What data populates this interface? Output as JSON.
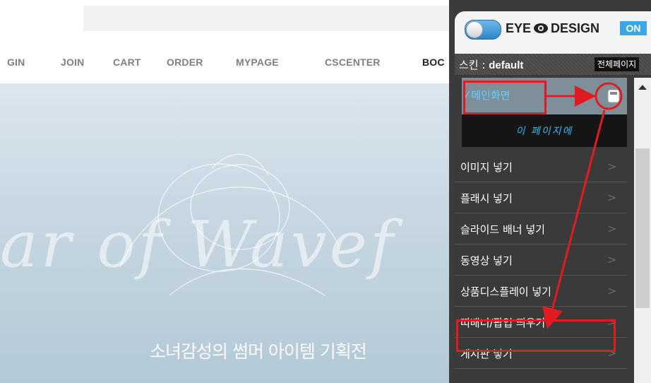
{
  "nav": {
    "items": [
      {
        "label": "GIN",
        "active": false
      },
      {
        "label": "JOIN",
        "active": false
      },
      {
        "label": "CART",
        "active": false
      },
      {
        "label": "ORDER",
        "active": false
      },
      {
        "label": "MYPAGE",
        "active": false
      },
      {
        "label": "CSCENTER",
        "active": false
      },
      {
        "label": "BOC",
        "active": true
      }
    ]
  },
  "banner": {
    "script_text": "ar of Wavef",
    "subtitle": "소녀감성의 썸머 아이템 기획전"
  },
  "panel": {
    "brand_left": "EYE",
    "brand_right": "DESIGN",
    "on_badge": "ON",
    "skin_prefix": "스킨 : ",
    "skin_name": "default",
    "all_pages_button": "전체페이지",
    "main_screen": "메인화면",
    "this_page_header": "이 페이지에",
    "menu_items": [
      {
        "label": "이미지 넣기"
      },
      {
        "label": "플래시 넣기"
      },
      {
        "label": "슬라이드 배너 넣기"
      },
      {
        "label": "동영상 넣기"
      },
      {
        "label": "상품디스플레이 넣기"
      },
      {
        "label": "띠배너/팝업 띄우기"
      },
      {
        "label": "게시판 넣기"
      }
    ],
    "toggle_state": "on"
  },
  "colors": {
    "accent_blue": "#39a7e6",
    "highlight_red": "#e11b22",
    "panel_bg": "#3a3a3a",
    "cyan_text": "#5fd0ff"
  },
  "icons": [
    "toggle-switch-icon",
    "eye-icon",
    "page-icon",
    "chevron-right-icon",
    "scroll-up-arrow-icon"
  ]
}
